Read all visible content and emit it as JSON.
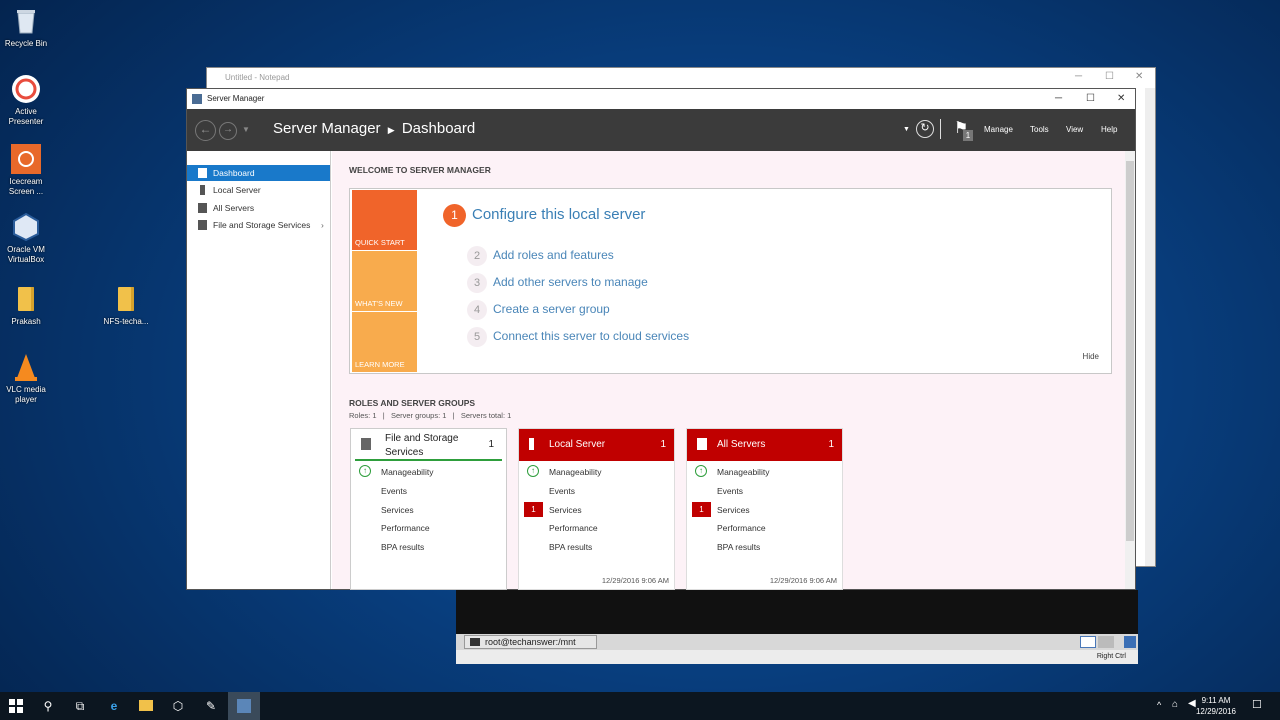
{
  "desktop": {
    "icons": [
      {
        "label": "Recycle Bin"
      },
      {
        "label": "Active Presenter"
      },
      {
        "label": "Icecream Screen ..."
      },
      {
        "label": "Oracle VM VirtualBox"
      },
      {
        "label": "Prakash"
      },
      {
        "label": "NFS-techa..."
      },
      {
        "label": "VLC media player"
      }
    ]
  },
  "notepad": {
    "title": "Untitled - Notepad"
  },
  "vm": {
    "terminal_tab": "root@techanswer:/mnt",
    "status_key": "Right Ctrl"
  },
  "server_manager": {
    "window_title": "Server Manager",
    "breadcrumb": {
      "root": "Server Manager",
      "page": "Dashboard"
    },
    "notification_count": "1",
    "menu": {
      "manage": "Manage",
      "tools": "Tools",
      "view": "View",
      "help": "Help"
    },
    "sidebar": [
      {
        "label": "Dashboard"
      },
      {
        "label": "Local Server"
      },
      {
        "label": "All Servers"
      },
      {
        "label": "File and Storage Services"
      }
    ],
    "welcome": {
      "heading": "WELCOME TO SERVER MANAGER",
      "tiles": [
        "QUICK START",
        "WHAT'S NEW",
        "LEARN MORE"
      ],
      "configure": {
        "num": "1",
        "text": "Configure this local server"
      },
      "steps": [
        {
          "num": "2",
          "text": "Add roles and features"
        },
        {
          "num": "3",
          "text": "Add other servers to manage"
        },
        {
          "num": "4",
          "text": "Create a server group"
        },
        {
          "num": "5",
          "text": "Connect this server to cloud services"
        }
      ],
      "hide": "Hide"
    },
    "roles": {
      "heading": "ROLES AND SERVER GROUPS",
      "summary": "Roles: 1   |   Server groups: 1   |   Servers total: 1",
      "cards": [
        {
          "title": "File and Storage Services",
          "count": "1",
          "rows": [
            "Manageability",
            "Events",
            "Services",
            "Performance",
            "BPA results"
          ],
          "timestamp": ""
        },
        {
          "title": "Local Server",
          "count": "1",
          "rows": [
            "Manageability",
            "Events",
            "Services",
            "Performance",
            "BPA results"
          ],
          "services_badge": "1",
          "timestamp": "12/29/2016 9:06 AM"
        },
        {
          "title": "All Servers",
          "count": "1",
          "rows": [
            "Manageability",
            "Events",
            "Services",
            "Performance",
            "BPA results"
          ],
          "services_badge": "1",
          "timestamp": "12/29/2016 9:06 AM"
        }
      ]
    }
  },
  "taskbar": {
    "time": "9:11 AM",
    "date": "12/29/2016"
  }
}
